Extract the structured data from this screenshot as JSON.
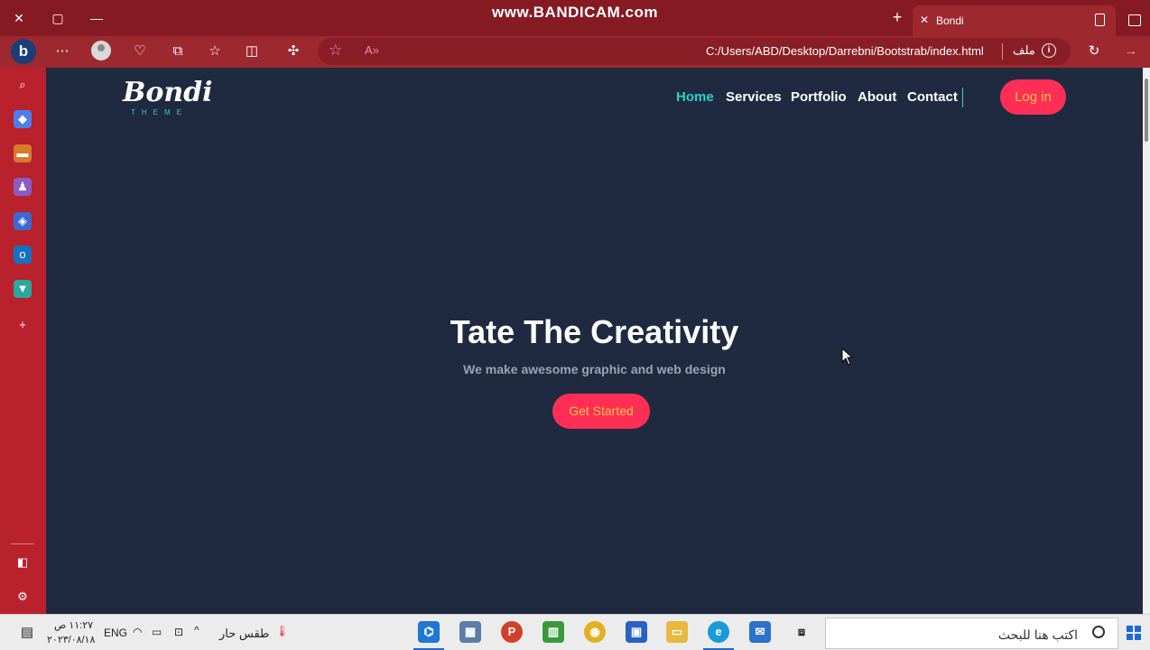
{
  "recorder": {
    "watermark": "www.BANDICAM.com"
  },
  "browser": {
    "tab": {
      "title": "Bondi"
    },
    "address": {
      "url": "C:/Users/ABD/Desktop/Darrebni/Bootstrab/index.html",
      "scheme_label": "ملف"
    },
    "accent_color": "#9e2830"
  },
  "page": {
    "logo": {
      "name": "Bondi",
      "sub": "THEME"
    },
    "nav": [
      {
        "label": "Home",
        "active": true
      },
      {
        "label": "Services",
        "active": false
      },
      {
        "label": "Portfolio",
        "active": false
      },
      {
        "label": "About",
        "active": false
      },
      {
        "label": "Contact",
        "active": false
      }
    ],
    "login_label": "Log in",
    "hero": {
      "title": "Tate The Creativity",
      "subtitle": "We make awesome graphic and web design",
      "cta": "Get Started"
    },
    "colors": {
      "background": "#1f2a40",
      "accent": "#ff2e55",
      "highlight": "#2fd0c7",
      "button_text": "#ffc74a"
    }
  },
  "taskbar": {
    "search_placeholder": "اكتب هنا للبحث",
    "weather": "طقس حار",
    "language": "ENG",
    "time": "١١:٢٧ ص",
    "date": "٢٠٢٣/٠٨/١٨"
  }
}
